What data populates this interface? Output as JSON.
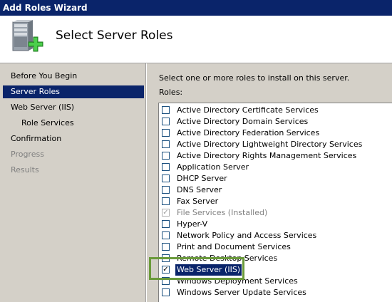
{
  "window": {
    "title": "Add Roles Wizard"
  },
  "header": {
    "title": "Select Server Roles",
    "icon": "server-add-icon"
  },
  "sidebar": {
    "items": [
      {
        "label": "Before You Begin",
        "state": "normal",
        "indent": false
      },
      {
        "label": "Server Roles",
        "state": "selected",
        "indent": false
      },
      {
        "label": "Web Server (IIS)",
        "state": "normal",
        "indent": false
      },
      {
        "label": "Role Services",
        "state": "normal",
        "indent": true
      },
      {
        "label": "Confirmation",
        "state": "normal",
        "indent": false
      },
      {
        "label": "Progress",
        "state": "disabled",
        "indent": false
      },
      {
        "label": "Results",
        "state": "disabled",
        "indent": false
      }
    ]
  },
  "main": {
    "instruction": "Select one or more roles to install on this server.",
    "roles_label": "Roles:",
    "roles": [
      {
        "label": "Active Directory Certificate Services",
        "checked": false
      },
      {
        "label": "Active Directory Domain Services",
        "checked": false
      },
      {
        "label": "Active Directory Federation Services",
        "checked": false
      },
      {
        "label": "Active Directory Lightweight Directory Services",
        "checked": false
      },
      {
        "label": "Active Directory Rights Management Services",
        "checked": false
      },
      {
        "label": "Application Server",
        "checked": false
      },
      {
        "label": "DHCP Server",
        "checked": false
      },
      {
        "label": "DNS Server",
        "checked": false
      },
      {
        "label": "Fax Server",
        "checked": false
      },
      {
        "label": "File Services  (Installed)",
        "checked": true,
        "disabled": true
      },
      {
        "label": "Hyper-V",
        "checked": false
      },
      {
        "label": "Network Policy and Access Services",
        "checked": false
      },
      {
        "label": "Print and Document Services",
        "checked": false
      },
      {
        "label": "Remote Desktop Services",
        "checked": false
      },
      {
        "label": "Web Server (IIS)",
        "checked": true,
        "selected": true
      },
      {
        "label": "Windows Deployment Services",
        "checked": false
      },
      {
        "label": "Windows Server Update Services",
        "checked": false
      }
    ]
  },
  "colors": {
    "selection": "#0a246a",
    "panel": "#d4d0c8",
    "highlight_outline": "#6a9a3a"
  }
}
